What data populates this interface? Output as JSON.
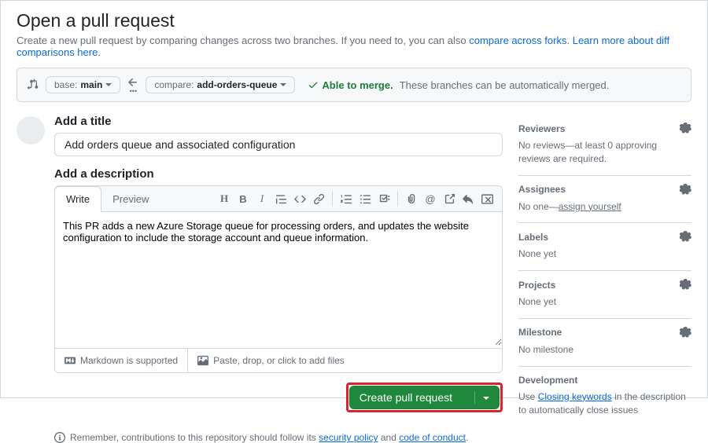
{
  "header": {
    "title": "Open a pull request",
    "subtitle_prefix": "Create a new pull request by comparing changes across two branches. If you need to, you can also ",
    "link_compare": "compare across forks",
    "subtitle_mid": ". ",
    "link_learn": "Learn more about diff comparisons here."
  },
  "compare": {
    "base_label": "base:",
    "base_value": "main",
    "compare_label": "compare:",
    "compare_value": "add-orders-queue",
    "merge_status": "Able to merge.",
    "merge_desc": "These branches can be automatically merged."
  },
  "form": {
    "title_label": "Add a title",
    "title_value": "Add orders queue and associated configuration",
    "desc_label": "Add a description",
    "tabs": {
      "write": "Write",
      "preview": "Preview"
    },
    "body": "This PR adds a new Azure Storage queue for processing orders, and updates the website configuration to include the storage account and queue information.",
    "md_hint": "Markdown is supported",
    "paste_hint": "Paste, drop, or click to add files",
    "submit": "Create pull request"
  },
  "sidebar": {
    "reviewers": {
      "title": "Reviewers",
      "body": "No reviews—at least 0 approving reviews are required."
    },
    "assignees": {
      "title": "Assignees",
      "body_prefix": "No one—",
      "link": "assign yourself"
    },
    "labels": {
      "title": "Labels",
      "body": "None yet"
    },
    "projects": {
      "title": "Projects",
      "body": "None yet"
    },
    "milestone": {
      "title": "Milestone",
      "body": "No milestone"
    },
    "development": {
      "title": "Development",
      "body_prefix": "Use ",
      "link": "Closing keywords",
      "body_suffix": " in the description to automatically close issues"
    }
  },
  "footer": {
    "prefix": "Remember, contributions to this repository should follow its ",
    "link1": "security policy",
    "mid": " and ",
    "link2": "code of conduct",
    "suffix": "."
  }
}
